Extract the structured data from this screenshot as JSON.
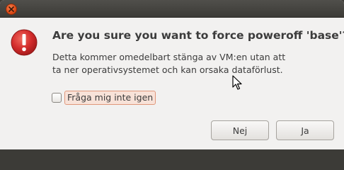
{
  "window": {
    "close_icon": "close-icon"
  },
  "dialog": {
    "icon": "warning-icon",
    "heading": "Are you sure you want to force poweroff 'base'?",
    "message_line1": "Detta kommer omedelbart stänga av VM:en utan att",
    "message_line2": "ta ner operativsystemet och kan orsaka dataförlust.",
    "checkbox_label": "Fråga mig inte igen",
    "checkbox_checked": false
  },
  "buttons": {
    "no_label": "Nej",
    "yes_label": "Ja"
  },
  "colors": {
    "accent_close": "#df4a16",
    "warning_red": "#d32c2c",
    "focus_highlight": "#f8e2d8"
  }
}
